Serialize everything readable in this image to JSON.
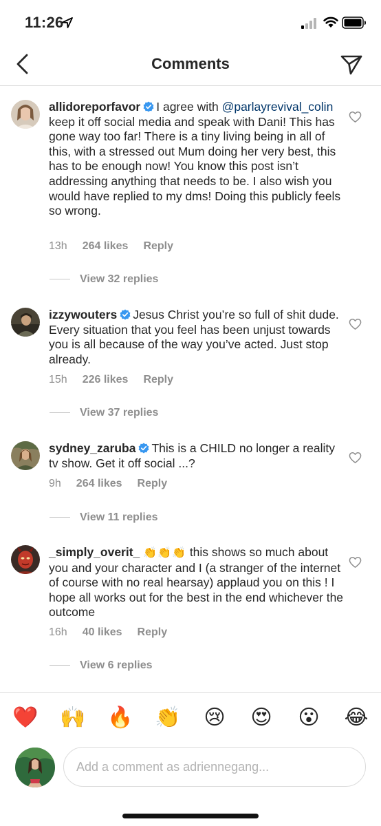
{
  "status_bar": {
    "time": "11:26"
  },
  "header": {
    "title": "Comments"
  },
  "comments": [
    {
      "username": "allidoreporfavor",
      "text_before": "I agree with",
      "mention": "@parlayrevival_colin",
      "text_after": "keep it off social media and speak with Dani! This has gone way too far! There is a tiny living being in all of this, with a stressed out Mum doing her very best, this has to be enough now! You know this post isn’t addressing anything that needs to be. I also wish you would have replied to my dms! Doing this publicly feels so wrong.",
      "time": "13h",
      "likes": "264 likes",
      "reply": "Reply",
      "view_replies": "View 32 replies"
    },
    {
      "username": "izzywouters",
      "text": "Jesus Christ you’re so full of shit dude. Every situation that you feel has been unjust towards you is all because of the way you’ve acted. Just stop already.",
      "time": "15h",
      "likes": "226 likes",
      "reply": "Reply",
      "view_replies": "View 37 replies"
    },
    {
      "username": "sydney_zaruba",
      "text": "This is a CHILD  no longer a reality tv show. Get it off social ...?",
      "time": "9h",
      "likes": "264 likes",
      "reply": "Reply",
      "view_replies": "View 11 replies"
    },
    {
      "username": "_simply_overit_",
      "emojis": "👏👏👏",
      "text": "this shows so much about you and your character and I (a stranger of the internet of course with no real hearsay) applaud you on this ! I hope all works out for the best in the end whichever the outcome",
      "time": "16h",
      "likes": "40 likes",
      "reply": "Reply",
      "view_replies": "View 6 replies"
    }
  ],
  "emoji_bar": [
    "❤️",
    "🙌",
    "🔥",
    "👏",
    "😢",
    "😍",
    "😮",
    "😂"
  ],
  "comment_input": {
    "placeholder": "Add a comment as adriennegang..."
  },
  "icons": {
    "back": "chevron-left-icon",
    "share": "paper-plane-icon",
    "verified": "verified-badge-icon",
    "like": "heart-outline-icon"
  },
  "colors": {
    "verified": "#3897f0",
    "mention": "#003569",
    "meta": "#8e8e8e",
    "text": "#262626"
  }
}
